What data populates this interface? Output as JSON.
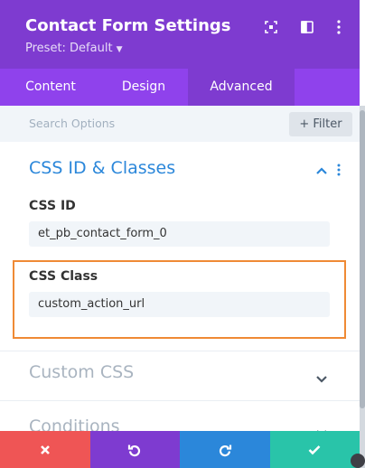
{
  "header": {
    "title": "Contact Form Settings",
    "preset": "Preset: Default",
    "icons": [
      "focus-icon",
      "sidebar-toggle-icon",
      "kebab-menu-icon"
    ]
  },
  "tabs": [
    {
      "label": "Content",
      "active": false
    },
    {
      "label": "Design",
      "active": false
    },
    {
      "label": "Advanced",
      "active": true
    }
  ],
  "search": {
    "placeholder": "Search Options",
    "filter_label": "+ Filter"
  },
  "section": {
    "title": "CSS ID & Classes",
    "css_id_label": "CSS ID",
    "css_id_value": "et_pb_contact_form_0",
    "css_class_label": "CSS Class",
    "css_class_value": "custom_action_url"
  },
  "collapsed_sections": [
    "Custom CSS",
    "Conditions"
  ],
  "footer_buttons": [
    "discard-icon",
    "undo-icon",
    "redo-icon",
    "save-icon"
  ],
  "colors": {
    "header": "#7e3bd0",
    "tabs": "#8f42ec",
    "accent_blue": "#2b87da",
    "highlight": "#ef8a35",
    "discard": "#ef5555",
    "undo": "#7e3bd0",
    "redo": "#2b87da",
    "save": "#29c4a9"
  }
}
